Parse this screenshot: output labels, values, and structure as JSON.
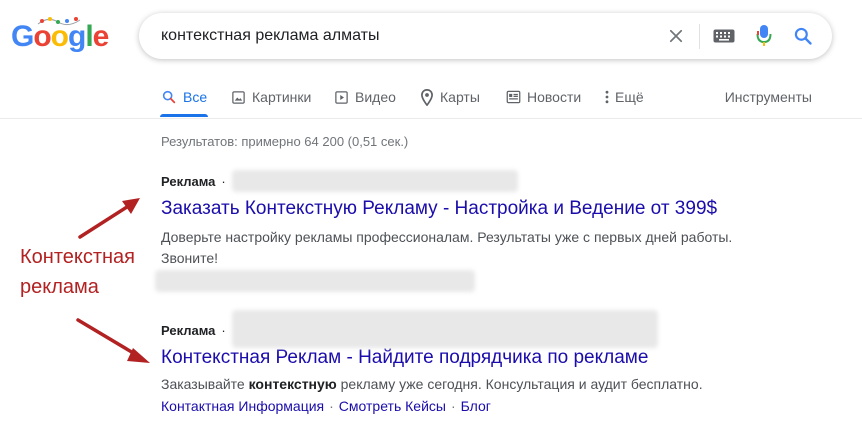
{
  "header": {
    "logo_letters": [
      "G",
      "o",
      "o",
      "g",
      "l",
      "e"
    ],
    "search_query": "контекстная реклама алматы"
  },
  "tabs": {
    "items": [
      {
        "label": "Все",
        "icon": "search-icon"
      },
      {
        "label": "Картинки",
        "icon": "image-icon"
      },
      {
        "label": "Видео",
        "icon": "video-icon"
      },
      {
        "label": "Карты",
        "icon": "map-pin-icon"
      },
      {
        "label": "Новости",
        "icon": "news-icon"
      },
      {
        "label": "Ещё",
        "icon": "more-vert-icon"
      }
    ],
    "tools_label": "Инструменты"
  },
  "results_stats": "Результатов: примерно 64 200 (0,51 сек.)",
  "ads": [
    {
      "label": "Реклама",
      "dot": "·",
      "title": "Заказать Контекстную Рекламу - Настройка и Ведение от 399$",
      "description": "Доверьте настройку рекламы профессионалам. Результаты уже с первых дней работы. Звоните!"
    },
    {
      "label": "Реклама",
      "dot": "·",
      "title": "Контекстная Реклам - Найдите подрядчика по рекламе",
      "description_pre": "Заказывайте ",
      "description_bold": "контекстную",
      "description_post": " рекламу уже сегодня. Консультация и аудит бесплатно.",
      "sitelinks": [
        "Контактная Информация",
        "Смотреть Кейсы",
        "Блог"
      ],
      "sitelink_sep": "·"
    }
  ],
  "annotation": {
    "line1": "Контекстная",
    "line2": "реклама",
    "color": "#b22222"
  },
  "colors": {
    "link": "#1a0dab",
    "active_tab": "#1a73e8",
    "google_blue": "#4285f4",
    "google_red": "#ea4335",
    "google_yellow": "#fbbc05",
    "google_green": "#34a853"
  }
}
